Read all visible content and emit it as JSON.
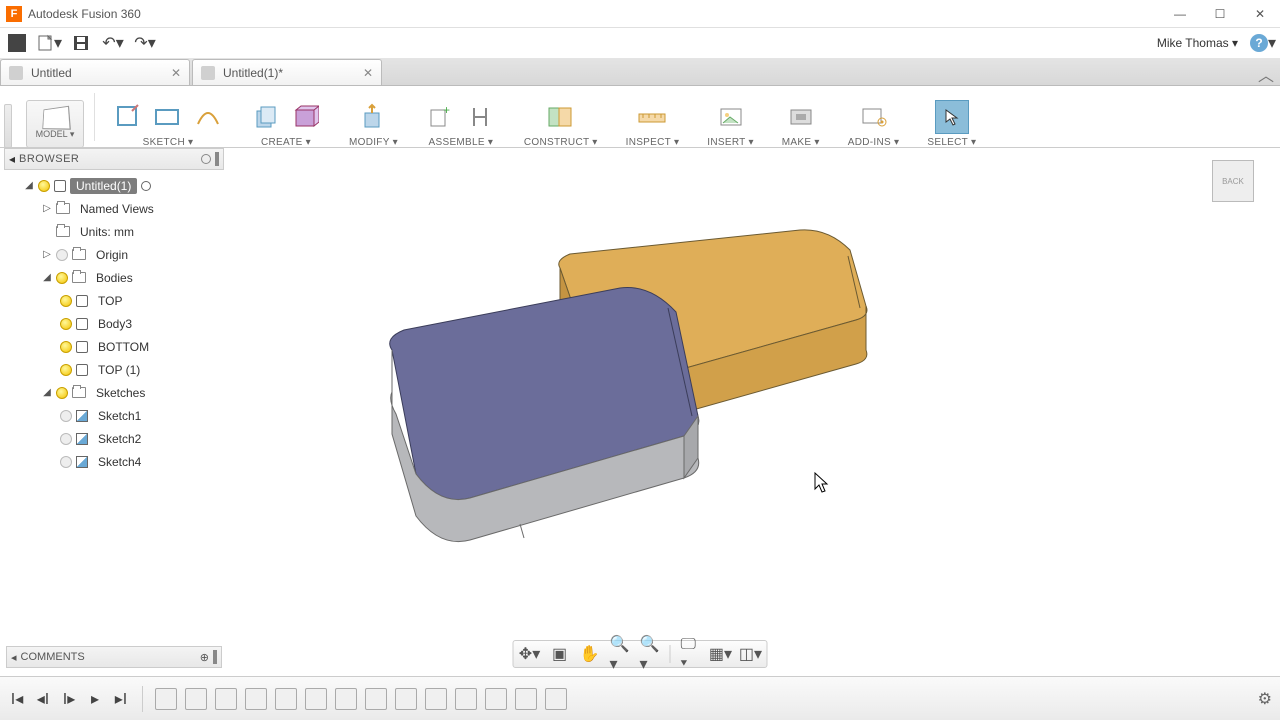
{
  "app": {
    "title": "Autodesk Fusion 360",
    "logo_letter": "F"
  },
  "user": {
    "name": "Mike Thomas ▾"
  },
  "tabs": [
    {
      "label": "Untitled",
      "modified": false
    },
    {
      "label": "Untitled(1)*",
      "modified": true
    }
  ],
  "ribbon": {
    "model": "MODEL ▾",
    "groups": [
      {
        "label": "SKETCH ▾"
      },
      {
        "label": "CREATE ▾"
      },
      {
        "label": "MODIFY ▾"
      },
      {
        "label": "ASSEMBLE ▾"
      },
      {
        "label": "CONSTRUCT ▾"
      },
      {
        "label": "INSPECT ▾"
      },
      {
        "label": "INSERT ▾"
      },
      {
        "label": "MAKE ▾"
      },
      {
        "label": "ADD-INS ▾"
      },
      {
        "label": "SELECT ▾"
      }
    ]
  },
  "browser": {
    "title": "BROWSER",
    "root": "Untitled(1)",
    "nodes": {
      "named_views": "Named Views",
      "units": "Units: mm",
      "origin": "Origin",
      "bodies": "Bodies",
      "body_top": "TOP",
      "body_body3": "Body3",
      "body_bottom": "BOTTOM",
      "body_top1": "TOP (1)",
      "sketches": "Sketches",
      "sketch1": "Sketch1",
      "sketch2": "Sketch2",
      "sketch4": "Sketch4"
    }
  },
  "comments": {
    "title": "COMMENTS"
  },
  "viewcube": {
    "face": "BACK"
  }
}
